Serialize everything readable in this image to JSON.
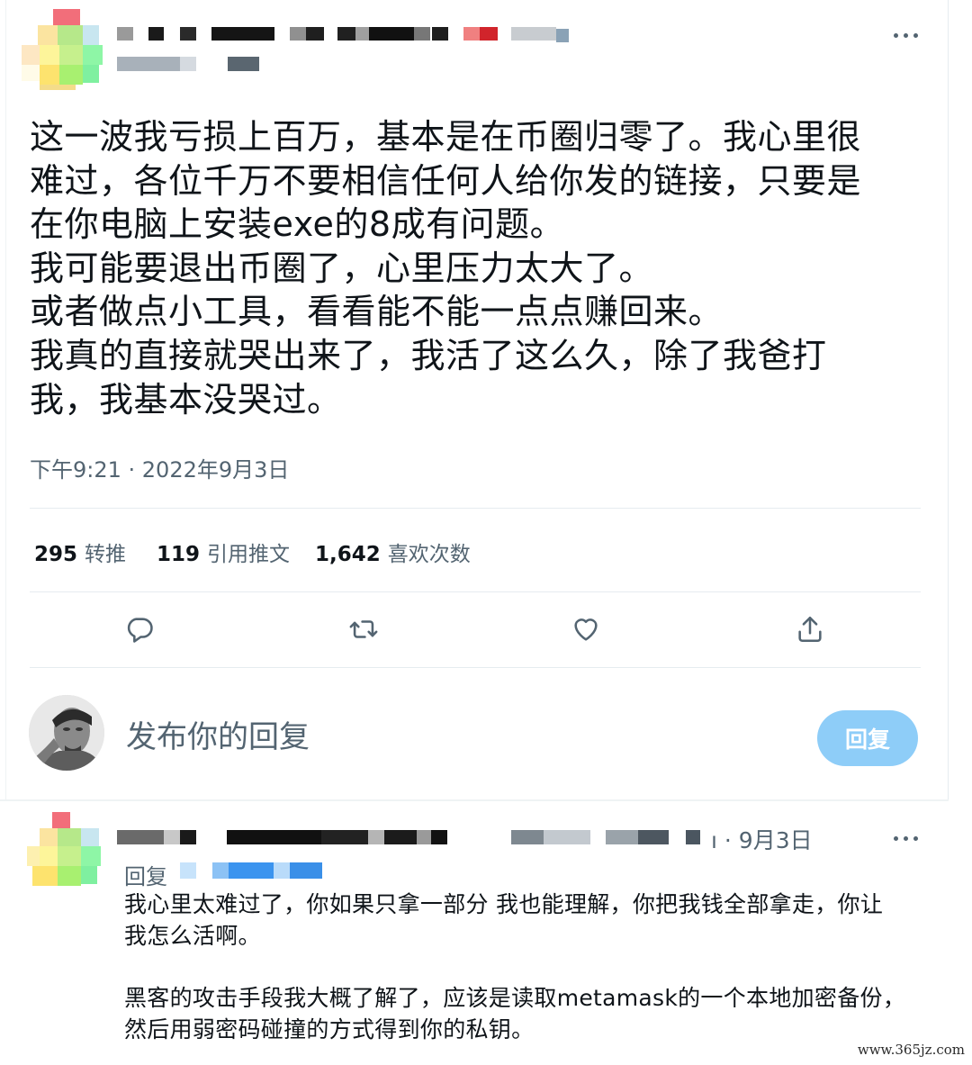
{
  "tweet": {
    "text": "这一波我亏损上百万，基本是在币圈归零了。我心里很\n难过，各位千万不要相信任何人给你发的链接，只要是\n在你电脑上安装exe的8成有问题。\n我可能要退出币圈了，心里压力太大了。\n或者做点小工具，看看能不能一点点赚回来。\n我真的直接就哭出来了，我活了这么久，除了我爸打\n我，我基本没哭过。",
    "timestamp": "下午9:21 · 2022年9月3日"
  },
  "stats": [
    {
      "count": "295",
      "label": "转推"
    },
    {
      "count": "119",
      "label": "引用推文"
    },
    {
      "count": "1,642",
      "label": "喜欢次数"
    }
  ],
  "actions": [
    {
      "icon": "reply-icon"
    },
    {
      "icon": "retweet-icon"
    },
    {
      "icon": "like-icon"
    },
    {
      "icon": "share-icon"
    }
  ],
  "composer": {
    "placeholder": "发布你的回复",
    "button_label": "回复"
  },
  "reply": {
    "date": "ı · 9月3日",
    "replying_label": "回复",
    "text": "我心里太难过了，你如果只拿一部分 我也能理解，你把我钱全部拿走，你让\n我怎么活啊。\n\n黑客的攻击手段我大概了解了，应该是读取metamask的一个本地加密备份，\n然后用弱密码碰撞的方式得到你的私钥。"
  },
  "watermark": "www.365jz.com",
  "colors": {
    "text": "#0f1419",
    "secondary": "#536471",
    "reply_button": "#8ecdf8",
    "link": "#1d9bf0"
  }
}
